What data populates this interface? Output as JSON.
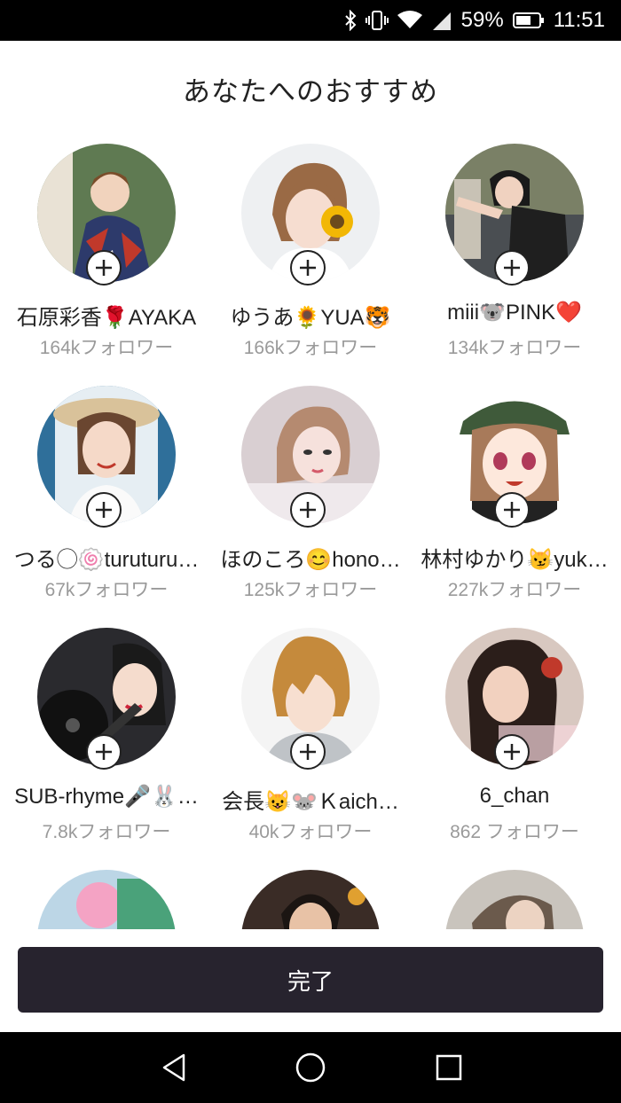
{
  "status_bar": {
    "battery_percent": "59%",
    "time": "11:51",
    "icons": [
      "bluetooth-icon",
      "vibrate-icon",
      "wifi-icon",
      "signal-icon",
      "battery-icon"
    ]
  },
  "title": "あなたへのおすすめ",
  "recommendations": [
    {
      "name": "石原彩香🌹AYAKA",
      "followers": "164kフォロワー"
    },
    {
      "name": "ゆうあ🌻YUA🐯",
      "followers": "166kフォロワー"
    },
    {
      "name": "miii🐨PINK❤️",
      "followers": "134kフォロワー"
    },
    {
      "name": "つる◯🍥turuturu…",
      "followers": "67kフォロワー"
    },
    {
      "name": "ほのころ😊hono…",
      "followers": "125kフォロワー"
    },
    {
      "name": "林村ゆかり😼yuk…",
      "followers": "227kフォロワー"
    },
    {
      "name": "SUB-rhyme🎤🐰…",
      "followers": "7.8kフォロワー"
    },
    {
      "name": "会長😺🐭Ｋaich…",
      "followers": "40kフォロワー"
    },
    {
      "name": "6_chan",
      "followers": "862 フォロワー"
    },
    {
      "name": "",
      "followers": ""
    },
    {
      "name": "",
      "followers": ""
    },
    {
      "name": "",
      "followers": ""
    }
  ],
  "done_button": "完了",
  "nav": {
    "icons": [
      "back-icon",
      "home-icon",
      "recents-icon"
    ]
  },
  "colors": {
    "button_bg": "#27232e",
    "follower_text": "#9a9a9a"
  }
}
